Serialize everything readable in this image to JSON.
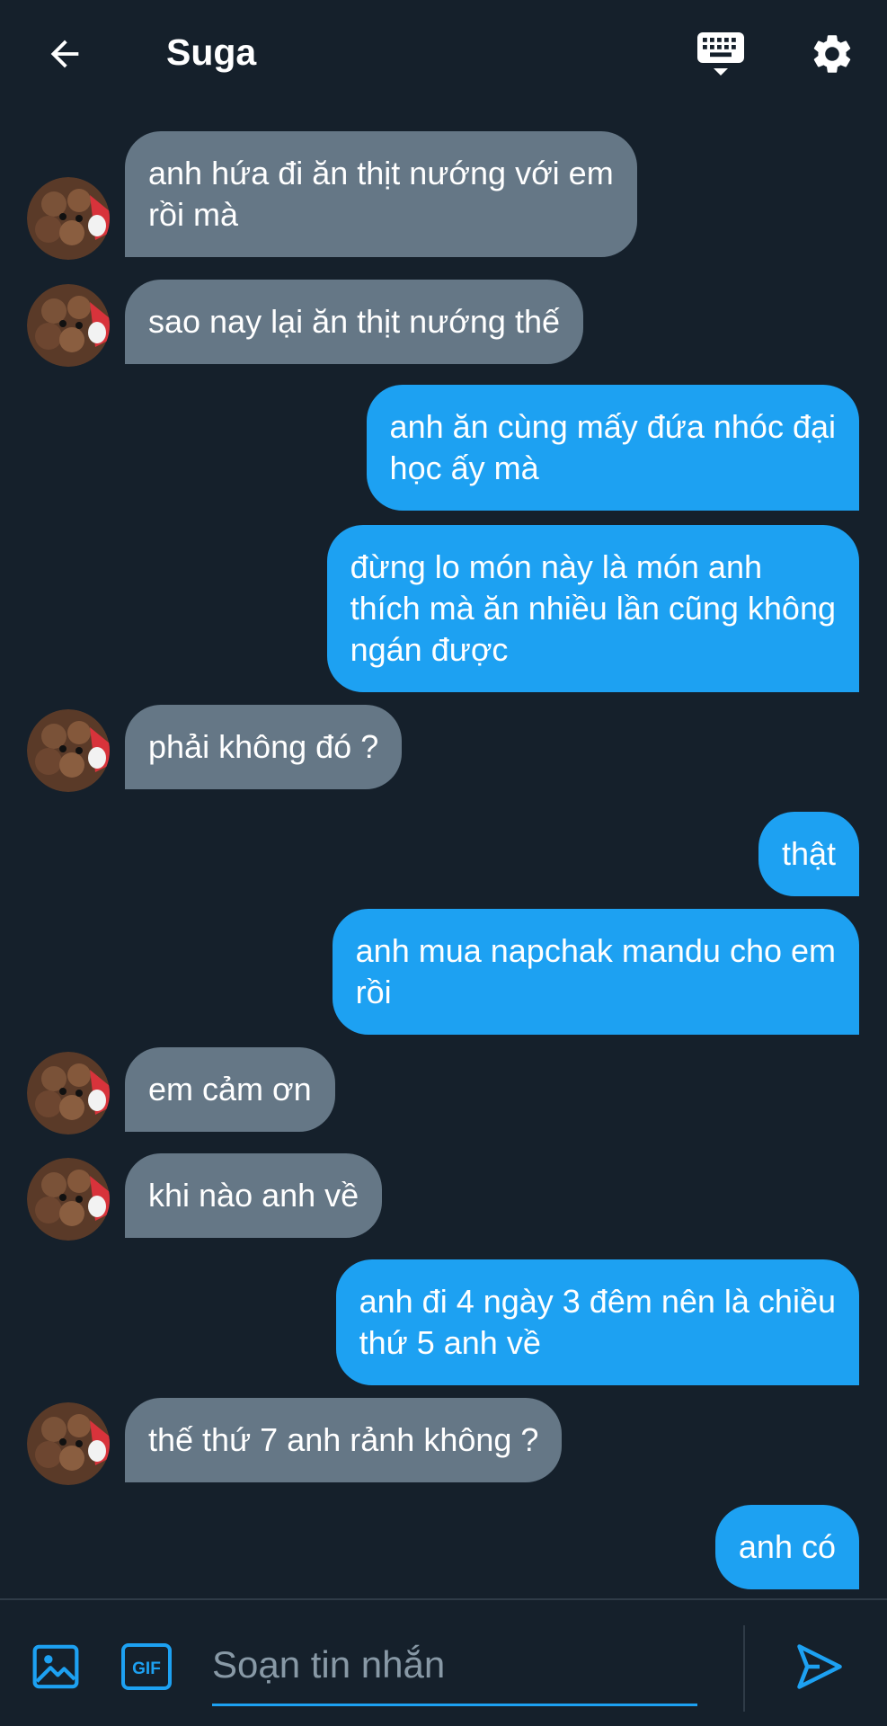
{
  "header": {
    "title": "Suga",
    "icons": {
      "back": "arrow-left-icon",
      "keyboard": "keyboard-icon",
      "settings": "gear-icon"
    }
  },
  "messages": [
    {
      "side": "received",
      "text": "anh hứa đi ăn thịt nướng với em\nrồi mà"
    },
    {
      "side": "received",
      "text": "sao nay lại ăn thịt nướng thế"
    },
    {
      "side": "sent",
      "text": "anh ăn cùng mấy đứa nhóc đại\nhọc ấy mà"
    },
    {
      "side": "sent",
      "text": "đừng lo món này là món anh\nthích mà ăn nhiều lần cũng không\nngán được"
    },
    {
      "side": "received",
      "text": "phải không đó ?"
    },
    {
      "side": "sent",
      "text": "thật"
    },
    {
      "side": "sent",
      "text": "anh mua napchak mandu cho em\nrồi"
    },
    {
      "side": "received",
      "text": "em cảm ơn"
    },
    {
      "side": "received",
      "text": "khi nào anh về"
    },
    {
      "side": "sent",
      "text": "anh đi 4 ngày 3 đêm nên là chiều\nthứ 5 anh về"
    },
    {
      "side": "received",
      "text": "thế thứ 7 anh rảnh không ?"
    },
    {
      "side": "sent",
      "text": "anh có"
    }
  ],
  "composer": {
    "placeholder": "Soạn tin nhắn",
    "value": "",
    "gif_label": "GIF",
    "icons": {
      "media": "image-icon",
      "gif": "gif-icon",
      "send": "send-icon"
    }
  },
  "colors": {
    "background": "#15202b",
    "received_bubble": "#657786",
    "sent_bubble": "#1da1f2",
    "accent": "#1da1f2",
    "placeholder": "#8899a6"
  }
}
